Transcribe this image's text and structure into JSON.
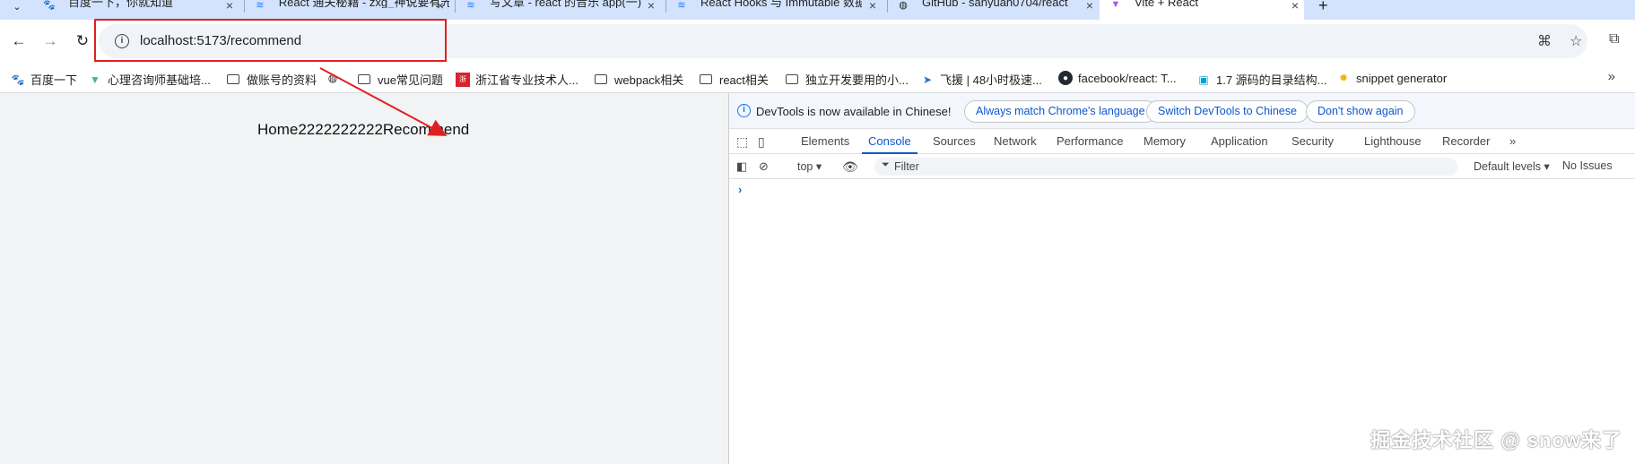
{
  "tabs": [
    {
      "title": "百度一下，你就知道",
      "favicon": "baidu-paw-icon"
    },
    {
      "title": "React 通关秘籍 - zxg_神说要有光",
      "favicon": "juejin-icon"
    },
    {
      "title": "写文章 - react 的音乐 app(一)",
      "favicon": "juejin-icon"
    },
    {
      "title": "React Hooks 与 Immutable 数据流",
      "favicon": "juejin-icon"
    },
    {
      "title": "GitHub - sanyuan0704/react",
      "favicon": "globe-icon"
    },
    {
      "title": "Vite + React",
      "favicon": "vite-icon",
      "active": true
    }
  ],
  "toolbar": {
    "url": "localhost:5173/recommend"
  },
  "bookmarks": [
    {
      "label": "百度一下",
      "icon": "baidu-paw-icon"
    },
    {
      "label": "心理咨询师基础培...",
      "icon": "vue-icon"
    },
    {
      "label": "做账号的资料",
      "icon": "folder-icon"
    },
    {
      "label": "",
      "icon": "globe-icon"
    },
    {
      "label": "vue常见问题",
      "icon": "folder-icon"
    },
    {
      "label": "浙江省专业技术人...",
      "icon": "red-logo-icon"
    },
    {
      "label": "webpack相关",
      "icon": "folder-icon"
    },
    {
      "label": "react相关",
      "icon": "folder-icon"
    },
    {
      "label": "独立开发要用的小...",
      "icon": "folder-icon"
    },
    {
      "label": "飞援 | 48小时极速...",
      "icon": "plane-icon"
    },
    {
      "label": "facebook/react: T...",
      "icon": "github-icon"
    },
    {
      "label": "1.7 源码的目录结构...",
      "icon": "bilibili-icon"
    },
    {
      "label": "snippet generator",
      "icon": "star-icon"
    }
  ],
  "page": {
    "text": "Home2222222222Recommend"
  },
  "devtools": {
    "info_text": "DevTools is now available in Chinese!",
    "buttons": [
      "Always match Chrome's language",
      "Switch DevTools to Chinese",
      "Don't show again"
    ],
    "tabs": [
      "Elements",
      "Console",
      "Sources",
      "Network",
      "Performance",
      "Memory",
      "Application",
      "Security",
      "Lighthouse",
      "Recorder"
    ],
    "active_tab": "Console",
    "context": "top",
    "filter_placeholder": "Filter",
    "levels": "Default levels",
    "issues": "No Issues"
  },
  "watermark": "掘金技术社区 @ snow来了",
  "colors": {
    "annotation": "#e02020",
    "accent": "#0b57d0"
  }
}
